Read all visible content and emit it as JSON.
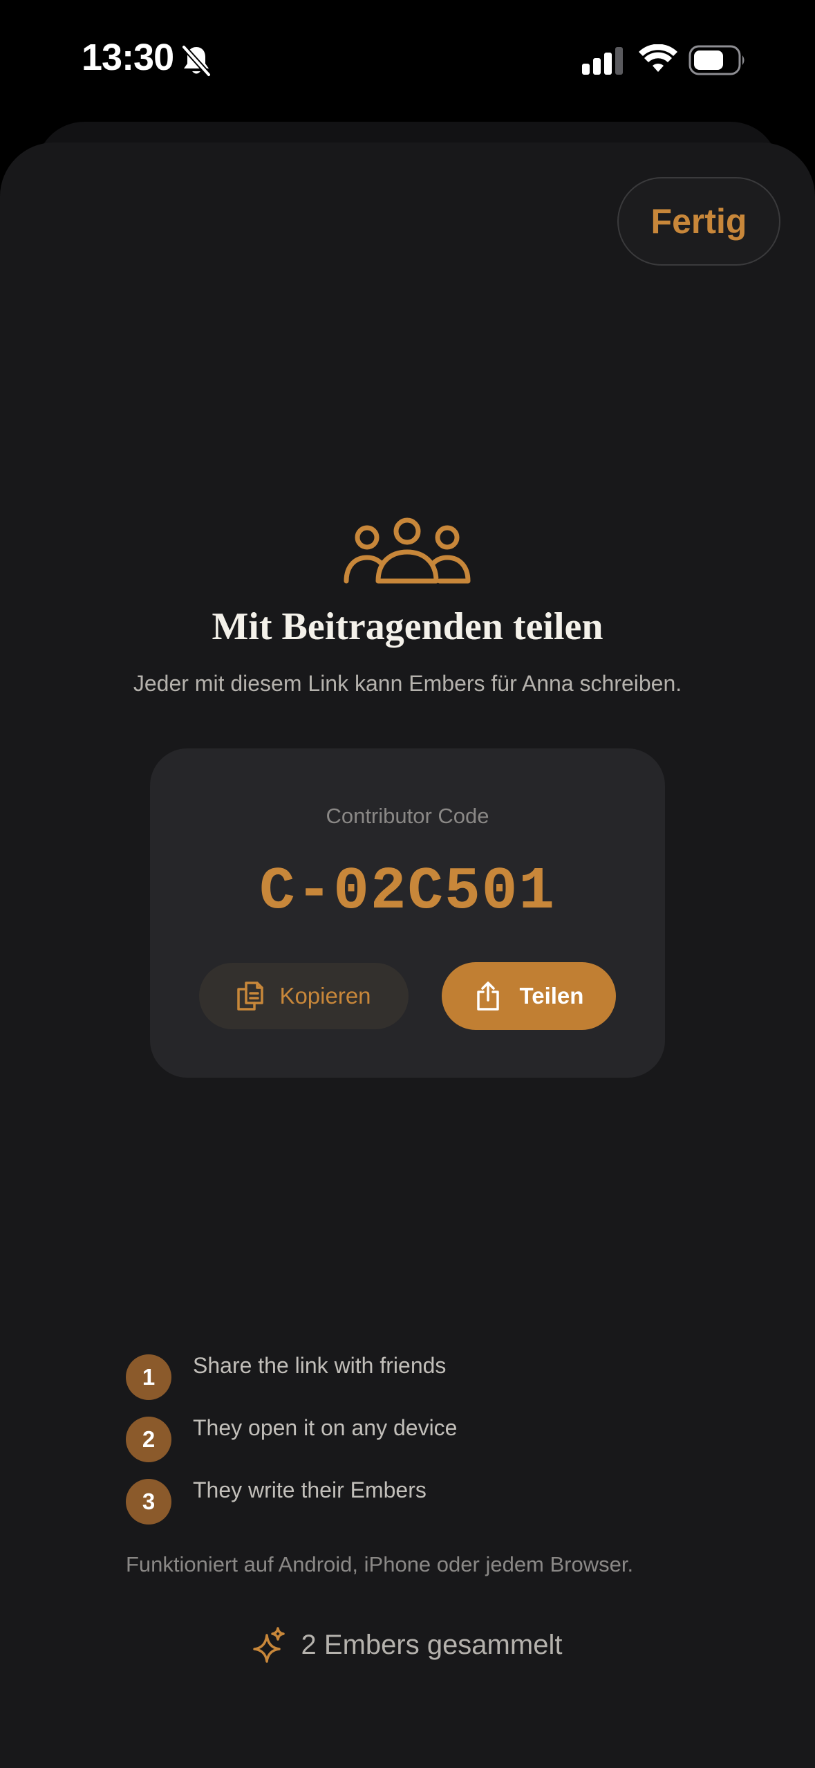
{
  "status_bar": {
    "time": "13:30",
    "icons": [
      "bell-slash-icon",
      "signal-icon",
      "wifi-icon",
      "battery-icon"
    ]
  },
  "header": {
    "done_label": "Fertig"
  },
  "hero": {
    "icon": "people-group-icon",
    "title": "Mit Beitragenden teilen",
    "subtitle": "Jeder mit diesem Link kann Embers für Anna schreiben."
  },
  "code_card": {
    "label": "Contributor Code",
    "code": "C-02C501",
    "copy_label": "Kopieren",
    "copy_icon": "copy-documents-icon",
    "share_label": "Teilen",
    "share_icon": "share-upload-icon"
  },
  "steps": [
    {
      "number": "1",
      "text": "Share the link with friends"
    },
    {
      "number": "2",
      "text": "They open it on any device"
    },
    {
      "number": "3",
      "text": "They write their Embers"
    }
  ],
  "footnote": "Funktioniert auf Android, iPhone oder jedem Browser.",
  "collected": {
    "icon": "sparkle-icon",
    "text": "2 Embers gesammelt"
  },
  "colors": {
    "accent": "#c8873a",
    "accent_button": "#c17f33",
    "step_badge": "#8b5a2b",
    "sheet_background": "#18181a",
    "card_background": "#262629"
  }
}
